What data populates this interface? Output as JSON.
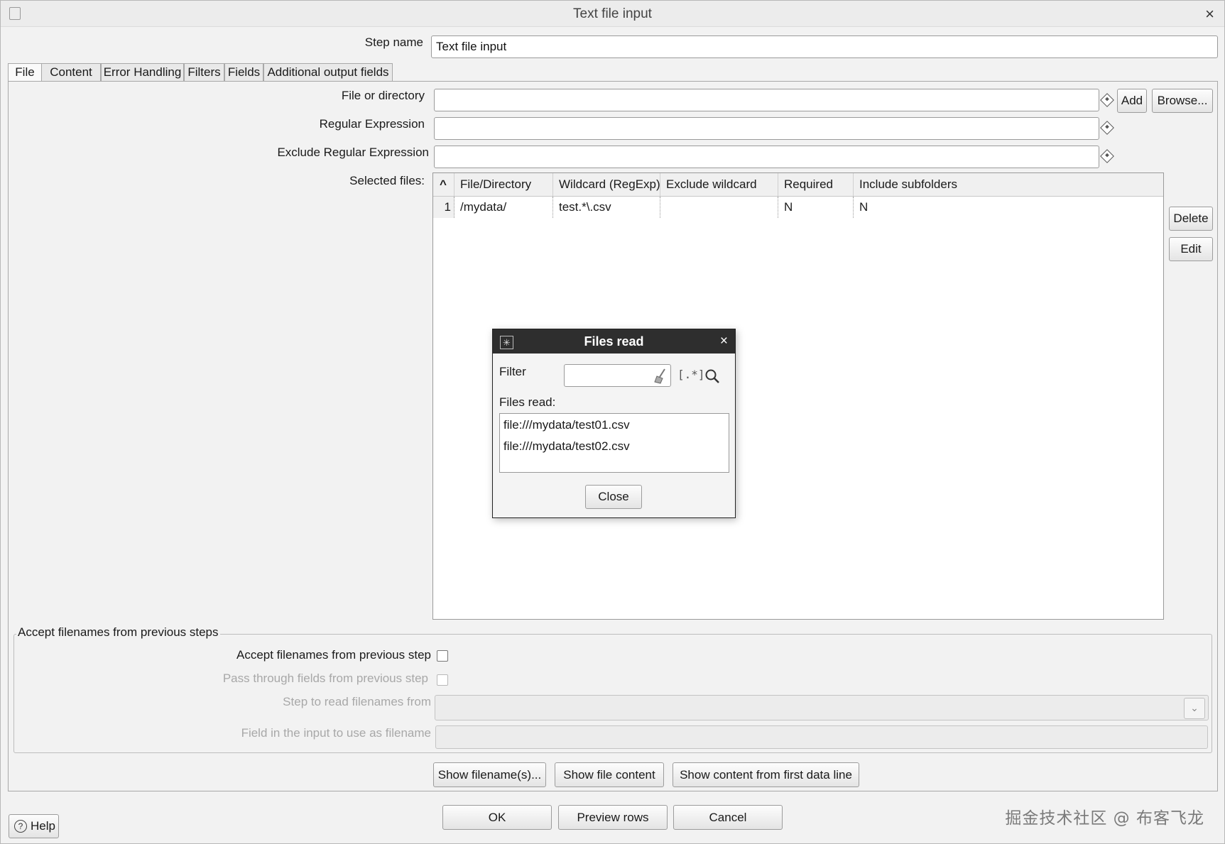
{
  "window": {
    "title": "Text file input",
    "close_glyph": "×"
  },
  "step_name": {
    "label": "Step name",
    "value": "Text file input"
  },
  "tabs": [
    {
      "label": "File"
    },
    {
      "label": "Content"
    },
    {
      "label": "Error Handling"
    },
    {
      "label": "Filters"
    },
    {
      "label": "Fields"
    },
    {
      "label": "Additional output fields"
    }
  ],
  "file_tab": {
    "file_or_directory": {
      "label": "File or directory",
      "value": ""
    },
    "regular_expression": {
      "label": "Regular Expression",
      "value": ""
    },
    "exclude_regular_expression": {
      "label": "Exclude Regular Expression",
      "value": ""
    },
    "add_button": "Add",
    "browse_button": "Browse...",
    "selected_files_label": "Selected files:",
    "delete_button": "Delete",
    "edit_button": "Edit",
    "table": {
      "sort_glyph": "^",
      "columns": [
        "File/Directory",
        "Wildcard (RegExp)",
        "Exclude wildcard",
        "Required",
        "Include subfolders"
      ],
      "rows": [
        {
          "num": "1",
          "file_directory": "/mydata/",
          "wildcard": "test.*\\.csv",
          "exclude_wildcard": "",
          "required": "N",
          "include_subfolders": "N"
        }
      ]
    }
  },
  "accept_group": {
    "title": "Accept filenames from previous steps",
    "accept_label": "Accept filenames from previous step",
    "pass_through_label": "Pass through fields from previous step",
    "step_to_read_label": "Step to read filenames from",
    "field_in_input_label": "Field in the input to use as filename",
    "accept_checked": false,
    "pass_through_checked": false
  },
  "show_buttons": {
    "show_filenames": "Show filename(s)...",
    "show_file_content": "Show file content",
    "show_content_first_line": "Show content from first data line"
  },
  "footer": {
    "help": "Help",
    "ok": "OK",
    "preview_rows": "Preview rows",
    "cancel": "Cancel",
    "watermark": "掘金技术社区 @ 布客飞龙"
  },
  "files_read_dialog": {
    "title": "Files read",
    "close_glyph": "×",
    "filter_label": "Filter",
    "filter_value": "",
    "regex_glyph": "[.*]",
    "files_read_label": "Files read:",
    "files": [
      "file:///mydata/test01.csv",
      "file:///mydata/test02.csv"
    ],
    "close_button": "Close"
  }
}
